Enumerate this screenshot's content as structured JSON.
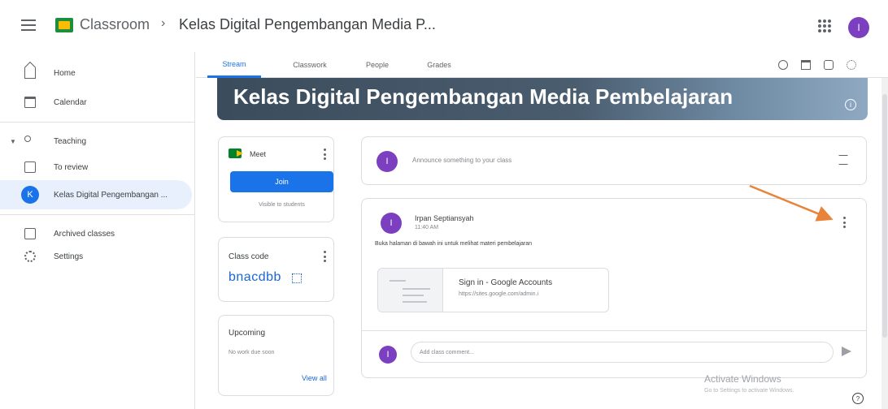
{
  "header": {
    "app_title": "Classroom",
    "separator": "›",
    "class_name": "Kelas Digital Pengembangan Media P...",
    "avatar_letter": "I"
  },
  "sidebar": {
    "items": [
      {
        "label": "Home",
        "icon": "home-icon"
      },
      {
        "label": "Calendar",
        "icon": "calendar-icon"
      },
      {
        "label": "Teaching",
        "icon": "teaching-icon"
      },
      {
        "label": "To review",
        "icon": "to-review-icon"
      },
      {
        "label": "Kelas Digital Pengembangan ...",
        "badge": "K"
      },
      {
        "label": "Archived classes",
        "icon": "archive-icon"
      },
      {
        "label": "Settings",
        "icon": "gear-icon"
      }
    ]
  },
  "tabs": [
    "Stream",
    "Classwork",
    "People",
    "Grades"
  ],
  "banner": {
    "title": "Kelas Digital Pengembangan Media Pembelajaran",
    "info_glyph": "i"
  },
  "meet": {
    "label": "Meet",
    "join_label": "Join",
    "visibility_note": "Visible to students"
  },
  "class_code": {
    "label": "Class code",
    "value": "bnacdbb"
  },
  "upcoming": {
    "title": "Upcoming",
    "note": "No work due soon",
    "view_all": "View all"
  },
  "announce": {
    "avatar_letter": "I",
    "placeholder": "Announce something to your class"
  },
  "post": {
    "avatar_letter": "I",
    "author": "Irpan Septiansyah",
    "time": "11:40 AM",
    "body": "Buka halaman di bawah ini untuk melihat materi pembelajaran",
    "attachment_title": "Sign in - Google Accounts",
    "attachment_url": "https://sites.google.com/admin.i",
    "comment_avatar_letter": "I",
    "comment_placeholder": "Add class comment..."
  },
  "watermark": {
    "title": "Activate Windows",
    "subtitle": "Go to Settings to activate Windows."
  },
  "help_glyph": "?",
  "colors": {
    "accent": "#1a73e8",
    "avatar": "#7b3fbf",
    "arrow": "#e8833a",
    "banner": "#3b4c5c"
  }
}
